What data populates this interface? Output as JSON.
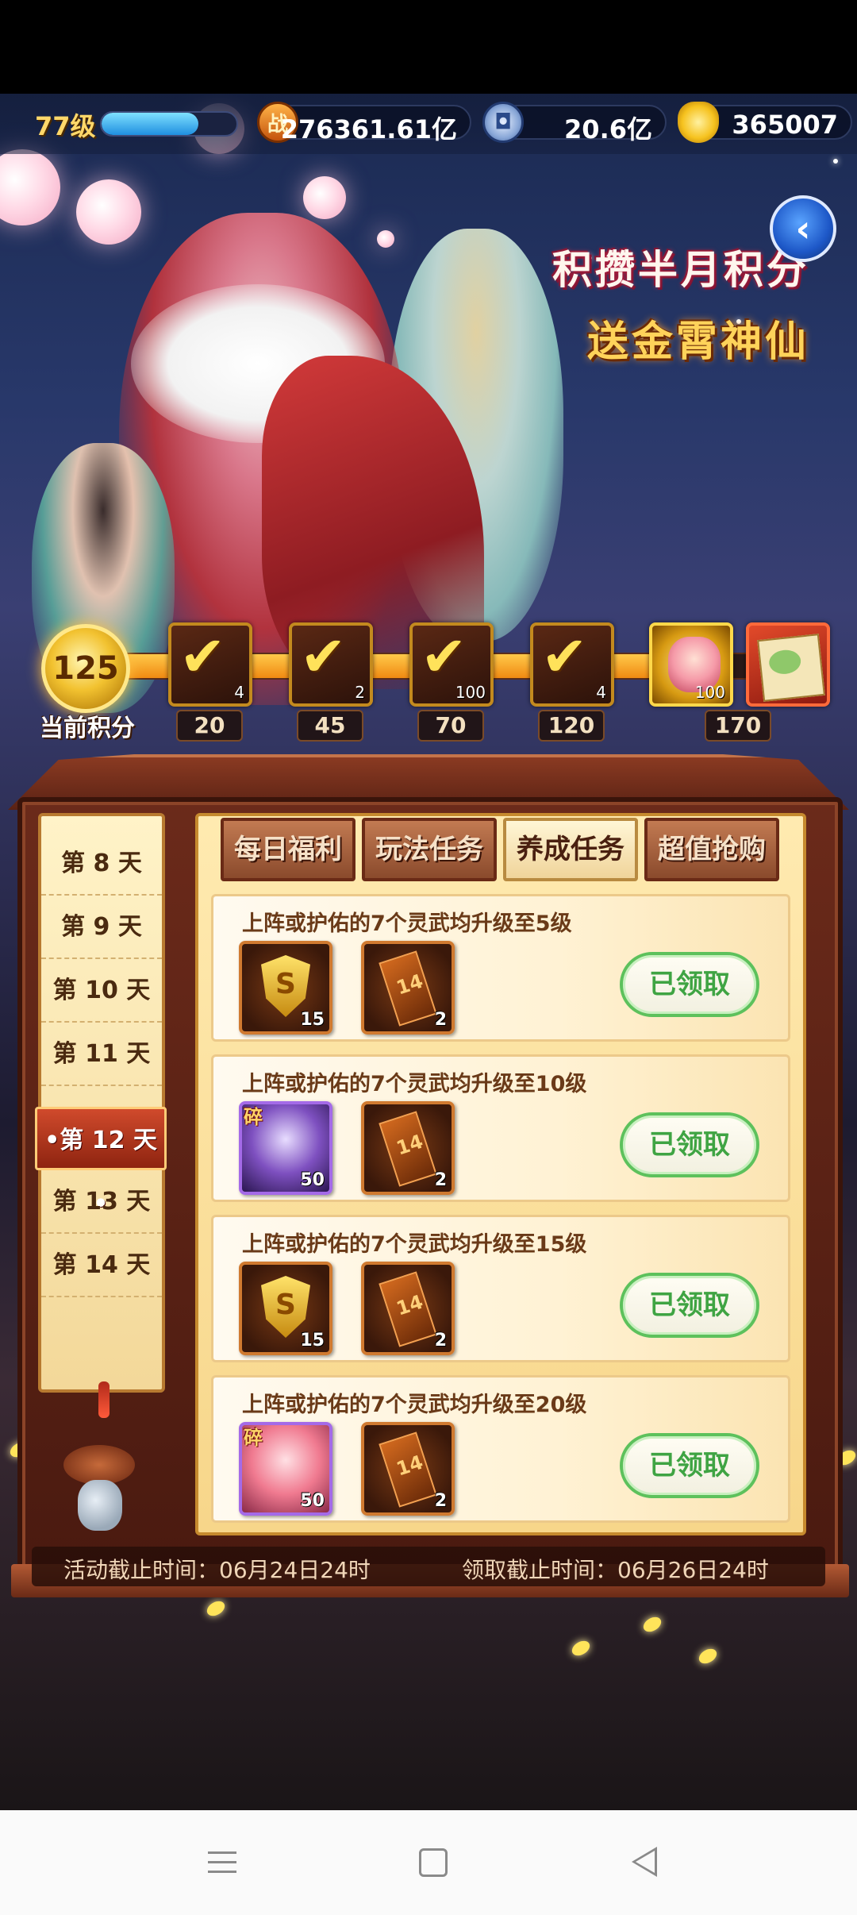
{
  "player": {
    "level": "77级",
    "xp_progress": 0.72,
    "power": "276361.61亿",
    "silver": "20.6亿",
    "gold": "365007"
  },
  "icons": {
    "power": "battle-power-icon",
    "silver": "silver-coin-icon",
    "gold": "gold-ingot-icon",
    "back": "back-arrow-icon"
  },
  "banner": {
    "line1": "积攒半月积分",
    "line2": "送金霄神仙"
  },
  "score": {
    "current": "125",
    "label": "当前积分",
    "progress": 0.78,
    "milestones": [
      {
        "points": "20",
        "count": "4",
        "claimed": true
      },
      {
        "points": "45",
        "count": "2",
        "claimed": true
      },
      {
        "points": "70",
        "count": "100",
        "claimed": true
      },
      {
        "points": "120",
        "count": "4",
        "claimed": true
      },
      {
        "points": "170",
        "count": "100",
        "claimed": false
      },
      {
        "points": "",
        "count": "",
        "claimed": false
      }
    ]
  },
  "days": [
    "第 8 天",
    "第 9 天",
    "第 10 天",
    "第 11 天",
    "•第 12 天•",
    "第 13 天",
    "第 14 天"
  ],
  "active_day_index": 4,
  "tabs": [
    "每日福利",
    "玩法任务",
    "养成任务",
    "超值抢购"
  ],
  "active_tab_index": 2,
  "tasks": [
    {
      "title": "上阵或护佑的7个灵武均升级至5级",
      "item1_count": "15",
      "item2_count": "2",
      "button": "已领取"
    },
    {
      "title": "上阵或护佑的7个灵武均升级至10级",
      "item1_tag": "碎",
      "item1_count": "50",
      "item2_count": "2",
      "button": "已领取"
    },
    {
      "title": "上阵或护佑的7个灵武均升级至15级",
      "item1_count": "15",
      "item2_count": "2",
      "button": "已领取"
    },
    {
      "title": "上阵或护佑的7个灵武均升级至20级",
      "item1_tag": "碎",
      "item1_count": "50",
      "item2_count": "2",
      "button": "已领取"
    }
  ],
  "footer": {
    "activity_deadline": "活动截止时间：06月24日24时",
    "claim_deadline": "领取截止时间：06月26日24时"
  },
  "colors": {
    "accent_gold": "#ffd35a",
    "claimed_green": "#3fa443",
    "panel_brown": "#6b2a1a"
  }
}
